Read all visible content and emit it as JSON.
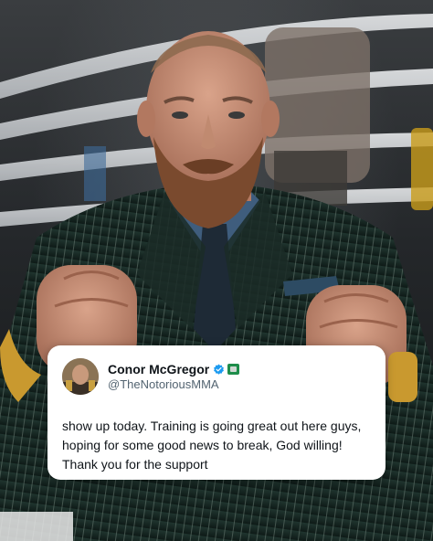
{
  "post": {
    "display_name": "Conor McGregor",
    "handle": "@TheNotoriousMMA",
    "text": "show up today. Training is going great out here guys, hoping for some good news to break, God willing! Thank you for the support",
    "verified_color": "#1d9bf0"
  },
  "icons": {
    "verified": "verified-badge-icon",
    "flag": "flag-emoji-icon"
  }
}
